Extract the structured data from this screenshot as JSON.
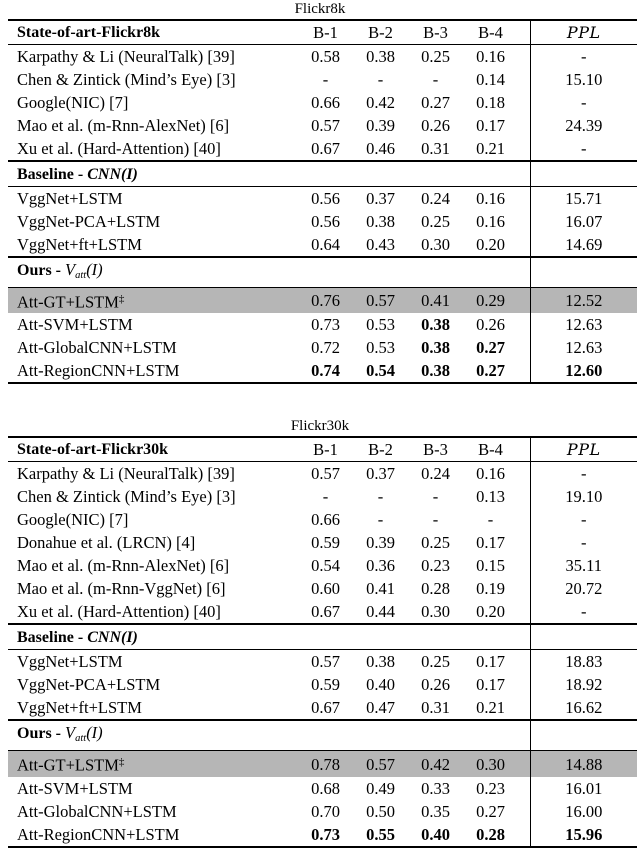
{
  "document": {
    "type": "results-tables",
    "tables": [
      {
        "caption": "Flickr8k",
        "columns": {
          "name_header": "State-of-art-Flickr8k",
          "b1": "B-1",
          "b2": "B-2",
          "b3": "B-3",
          "b4": "B-4",
          "ppl": "PPL"
        },
        "sections": [
          {
            "header": null,
            "rows": [
              {
                "name": "Karpathy & Li (NeuralTalk) [39]",
                "b1": "0.58",
                "b2": "0.38",
                "b3": "0.25",
                "b4": "0.16",
                "ppl": "-",
                "bold": [],
                "highlight": false
              },
              {
                "name": "Chen & Zintick (Mind’s Eye) [3]",
                "b1": "-",
                "b2": "-",
                "b3": "-",
                "b4": "0.14",
                "ppl": "15.10",
                "bold": [],
                "highlight": false
              },
              {
                "name": "Google(NIC) [7]",
                "b1": "0.66",
                "b2": "0.42",
                "b3": "0.27",
                "b4": "0.18",
                "ppl": "-",
                "bold": [],
                "highlight": false
              },
              {
                "name": "Mao et al. (m-Rnn-AlexNet) [6]",
                "b1": "0.57",
                "b2": "0.39",
                "b3": "0.26",
                "b4": "0.17",
                "ppl": "24.39",
                "bold": [],
                "highlight": false
              },
              {
                "name": "Xu et al. (Hard-Attention) [40]",
                "b1": "0.67",
                "b2": "0.46",
                "b3": "0.31",
                "b4": "0.21",
                "ppl": "-",
                "bold": [],
                "highlight": false
              }
            ]
          },
          {
            "header_prefix": "Baseline - ",
            "header_math": "CNN(I)",
            "rows": [
              {
                "name": "VggNet+LSTM",
                "b1": "0.56",
                "b2": "0.37",
                "b3": "0.24",
                "b4": "0.16",
                "ppl": "15.71",
                "bold": [],
                "highlight": false
              },
              {
                "name": "VggNet-PCA+LSTM",
                "b1": "0.56",
                "b2": "0.38",
                "b3": "0.25",
                "b4": "0.16",
                "ppl": "16.07",
                "bold": [],
                "highlight": false
              },
              {
                "name": "VggNet+ft+LSTM",
                "b1": "0.64",
                "b2": "0.43",
                "b3": "0.30",
                "b4": "0.20",
                "ppl": "14.69",
                "bold": [],
                "highlight": false
              }
            ]
          },
          {
            "header_prefix": "Ours - ",
            "header_math_v": "V",
            "header_math_sub": "att",
            "header_math_tail": "(I)",
            "rows": [
              {
                "name": "Att-GT+LSTM",
                "dagger": "‡",
                "b1": "0.76",
                "b2": "0.57",
                "b3": "0.41",
                "b4": "0.29",
                "ppl": "12.52",
                "bold": [],
                "highlight": true
              },
              {
                "name": "Att-SVM+LSTM",
                "b1": "0.73",
                "b2": "0.53",
                "b3": "0.38",
                "b4": "0.26",
                "ppl": "12.63",
                "bold": [
                  "b3"
                ],
                "highlight": false
              },
              {
                "name": "Att-GlobalCNN+LSTM",
                "b1": "0.72",
                "b2": "0.53",
                "b3": "0.38",
                "b4": "0.27",
                "ppl": "12.63",
                "bold": [
                  "b3",
                  "b4"
                ],
                "highlight": false
              },
              {
                "name": "Att-RegionCNN+LSTM",
                "b1": "0.74",
                "b2": "0.54",
                "b3": "0.38",
                "b4": "0.27",
                "ppl": "12.60",
                "bold": [
                  "b1",
                  "b2",
                  "b3",
                  "b4",
                  "ppl"
                ],
                "highlight": false
              }
            ]
          }
        ]
      },
      {
        "caption": "Flickr30k",
        "columns": {
          "name_header": "State-of-art-Flickr30k",
          "b1": "B-1",
          "b2": "B-2",
          "b3": "B-3",
          "b4": "B-4",
          "ppl": "PPL"
        },
        "sections": [
          {
            "header": null,
            "rows": [
              {
                "name": "Karpathy & Li (NeuralTalk) [39]",
                "b1": "0.57",
                "b2": "0.37",
                "b3": "0.24",
                "b4": "0.16",
                "ppl": "-",
                "bold": [],
                "highlight": false
              },
              {
                "name": "Chen & Zintick (Mind’s Eye) [3]",
                "b1": "-",
                "b2": "-",
                "b3": "-",
                "b4": "0.13",
                "ppl": "19.10",
                "bold": [],
                "highlight": false
              },
              {
                "name": "Google(NIC) [7]",
                "b1": "0.66",
                "b2": "-",
                "b3": "-",
                "b4": "-",
                "ppl": "-",
                "bold": [],
                "highlight": false
              },
              {
                "name": "Donahue et al. (LRCN) [4]",
                "b1": "0.59",
                "b2": "0.39",
                "b3": "0.25",
                "b4": "0.17",
                "ppl": "-",
                "bold": [],
                "highlight": false
              },
              {
                "name": "Mao et al. (m-Rnn-AlexNet) [6]",
                "b1": "0.54",
                "b2": "0.36",
                "b3": "0.23",
                "b4": "0.15",
                "ppl": "35.11",
                "bold": [],
                "highlight": false
              },
              {
                "name": "Mao et al. (m-Rnn-VggNet) [6]",
                "b1": "0.60",
                "b2": "0.41",
                "b3": "0.28",
                "b4": "0.19",
                "ppl": "20.72",
                "bold": [],
                "highlight": false
              },
              {
                "name": "Xu et al. (Hard-Attention) [40]",
                "b1": "0.67",
                "b2": "0.44",
                "b3": "0.30",
                "b4": "0.20",
                "ppl": "-",
                "bold": [],
                "highlight": false
              }
            ]
          },
          {
            "header_prefix": "Baseline - ",
            "header_math": "CNN(I)",
            "rows": [
              {
                "name": "VggNet+LSTM",
                "b1": "0.57",
                "b2": "0.38",
                "b3": "0.25",
                "b4": "0.17",
                "ppl": "18.83",
                "bold": [],
                "highlight": false
              },
              {
                "name": "VggNet-PCA+LSTM",
                "b1": "0.59",
                "b2": "0.40",
                "b3": "0.26",
                "b4": "0.17",
                "ppl": "18.92",
                "bold": [],
                "highlight": false
              },
              {
                "name": "VggNet+ft+LSTM",
                "b1": "0.67",
                "b2": "0.47",
                "b3": "0.31",
                "b4": "0.21",
                "ppl": "16.62",
                "bold": [],
                "highlight": false
              }
            ]
          },
          {
            "header_prefix": "Ours - ",
            "header_math_v": "V",
            "header_math_sub": "att",
            "header_math_tail": "(I)",
            "rows": [
              {
                "name": "Att-GT+LSTM",
                "dagger": "‡",
                "b1": "0.78",
                "b2": "0.57",
                "b3": "0.42",
                "b4": "0.30",
                "ppl": "14.88",
                "bold": [],
                "highlight": true
              },
              {
                "name": "Att-SVM+LSTM",
                "b1": "0.68",
                "b2": "0.49",
                "b3": "0.33",
                "b4": "0.23",
                "ppl": "16.01",
                "bold": [],
                "highlight": false
              },
              {
                "name": "Att-GlobalCNN+LSTM",
                "b1": "0.70",
                "b2": "0.50",
                "b3": "0.35",
                "b4": "0.27",
                "ppl": "16.00",
                "bold": [],
                "highlight": false
              },
              {
                "name": "Att-RegionCNN+LSTM",
                "b1": "0.73",
                "b2": "0.55",
                "b3": "0.40",
                "b4": "0.28",
                "ppl": "15.96",
                "bold": [
                  "b1",
                  "b2",
                  "b3",
                  "b4",
                  "ppl"
                ],
                "highlight": false
              }
            ]
          }
        ]
      }
    ]
  },
  "style": {
    "highlight_color": "#b6b6b6",
    "rule_color": "#000000",
    "background": "#ffffff"
  }
}
